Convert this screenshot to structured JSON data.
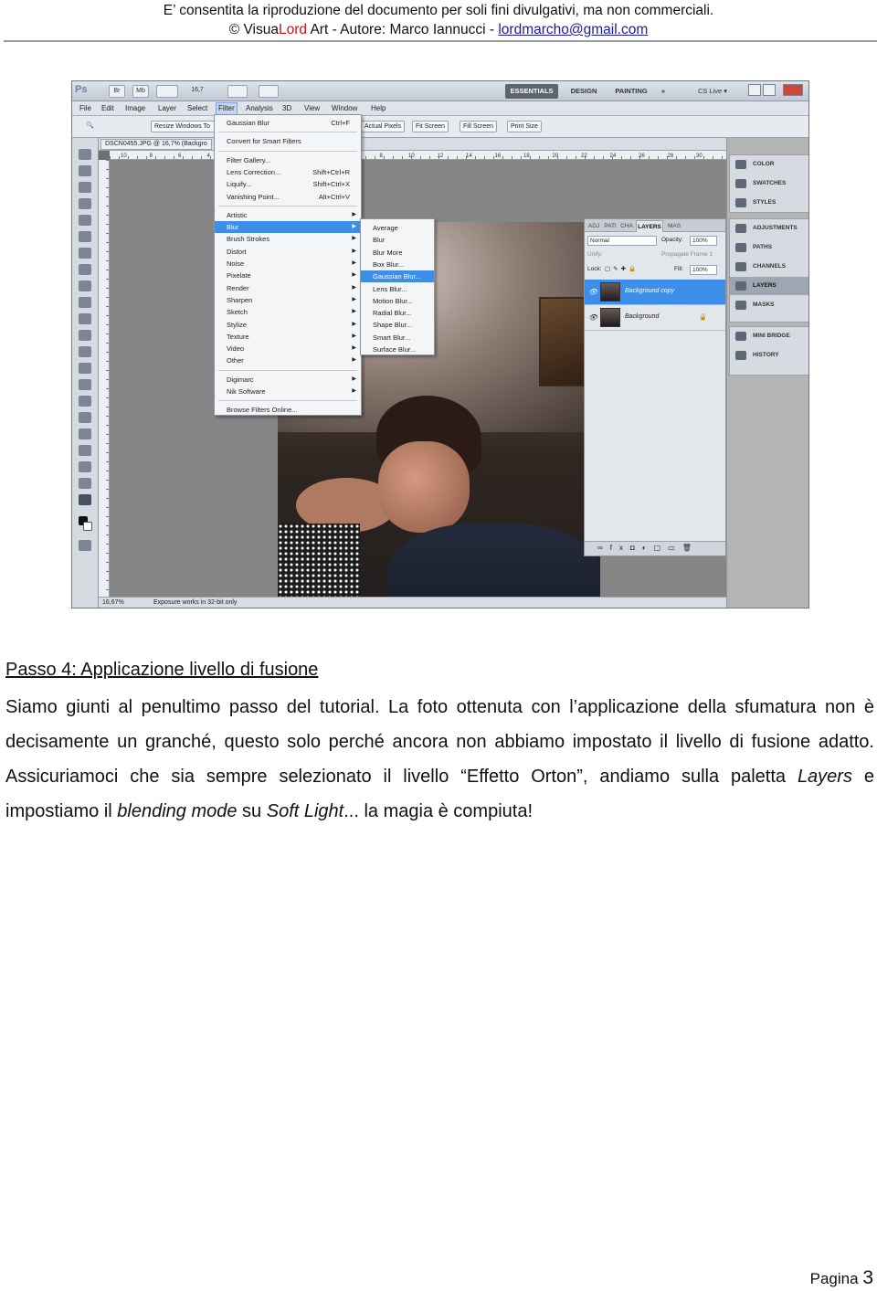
{
  "header": {
    "line1": "E’ consentita la riproduzione del documento per soli fini divulgativi, ma non commerciali.",
    "line2_prefix": "© Visua",
    "line2_red": "Lord",
    "line2_mid": " Art - Autore: Marco Iannucci - ",
    "email": "lordmarcho@gmail.com"
  },
  "ps": {
    "logo": "Ps",
    "app_buttons": [
      "Br",
      "Mb",
      "16,7"
    ],
    "workspaces": [
      "ESSENTIALS",
      "DESIGN",
      "PAINTING",
      "»",
      "CS Live ▾"
    ],
    "menu": [
      "File",
      "Edit",
      "Image",
      "Layer",
      "Select",
      "Filter",
      "Analysis",
      "3D",
      "View",
      "Window",
      "Help"
    ],
    "options": [
      "Resize Windows To",
      "Actual Pixels",
      "Fit Screen",
      "Fill Screen",
      "Print Size"
    ],
    "doc_tab": "DSCN0455.JPG @ 16,7% (Backgro",
    "ruler_marks": [
      "10",
      "8",
      "6",
      "4",
      "2",
      "0",
      "2",
      "4",
      "6",
      "8",
      "10",
      "12",
      "14",
      "16",
      "18",
      "20",
      "22",
      "24",
      "26",
      "28",
      "30"
    ],
    "status": {
      "zoom": "16,67%",
      "info": "Exposure works in 32-bit only"
    },
    "filter_menu": {
      "top": [
        {
          "label": "Gaussian Blur",
          "shortcut": "Ctrl+F"
        },
        {
          "label": "Convert for Smart Filters",
          "shortcut": ""
        },
        {
          "label": "Filter Gallery...",
          "shortcut": ""
        },
        {
          "label": "Lens Correction...",
          "shortcut": "Shift+Ctrl+R"
        },
        {
          "label": "Liquify...",
          "shortcut": "Shift+Ctrl+X"
        },
        {
          "label": "Vanishing Point...",
          "shortcut": "Alt+Ctrl+V"
        }
      ],
      "groups": [
        "Artistic",
        "Blur",
        "Brush Strokes",
        "Distort",
        "Noise",
        "Pixelate",
        "Render",
        "Sharpen",
        "Sketch",
        "Stylize",
        "Texture",
        "Video",
        "Other"
      ],
      "plugins": [
        "Digimarc",
        "Nik Software"
      ],
      "browse": "Browse Filters Online..."
    },
    "blur_menu": [
      "Average",
      "Blur",
      "Blur More",
      "Box Blur...",
      "Gaussian Blur...",
      "Lens Blur...",
      "Motion Blur...",
      "Radial Blur...",
      "Shape Blur...",
      "Smart Blur...",
      "Surface Blur..."
    ],
    "layers_panel": {
      "tabs": [
        "ADJ",
        "PATI",
        "CHA",
        "LAYERS",
        "MAS"
      ],
      "blend_mode": "Normal",
      "opacity_label": "Opacity:",
      "opacity": "100%",
      "unify_label": "Unify:",
      "propagate": "Propagate Frame 1",
      "lock_label": "Lock:",
      "fill_label": "Fill:",
      "fill": "100%",
      "layers": [
        "Background copy",
        "Background"
      ]
    },
    "dock_top": [
      "COLOR",
      "SWATCHES",
      "STYLES"
    ],
    "dock_mid": [
      "ADJUSTMENTS",
      "PATHS",
      "CHANNELS",
      "LAYERS",
      "MASKS"
    ],
    "dock_bottom": [
      "MINI BRIDGE",
      "HISTORY"
    ]
  },
  "body": {
    "title": "Passo 4: Applicazione livello di fusione",
    "p1": "Siamo giunti al penultimo passo del tutorial. La foto ottenuta con l’applicazione della sfumatura non è decisamente un granché, questo solo perché ancora non abbiamo impostato il livello di fusione adatto. Assicuriamoci che sia sempre selezionato il livello “Effetto Orton”, andiamo sulla paletta ",
    "em1": "Layers",
    "p2": " e impostiamo il ",
    "em2": "blending mode",
    "p3": " su ",
    "em3": "Soft Light",
    "p4": "... la magia è compiuta!"
  },
  "footer": {
    "label": "Pagina",
    "page": "3"
  }
}
